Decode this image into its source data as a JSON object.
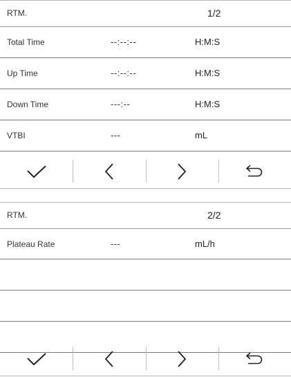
{
  "panels": [
    {
      "title": "RTM.",
      "page": "1/2",
      "rows": [
        {
          "label": "Total Time",
          "value": "--:--:--",
          "unit": "H:M:S"
        },
        {
          "label": "Up Time",
          "value": "--:--:--",
          "unit": "H:M:S"
        },
        {
          "label": "Down Time",
          "value": "---:--",
          "unit": "H:M:S"
        },
        {
          "label": "VTBI",
          "value": "---",
          "unit": "mL"
        }
      ],
      "toolbar": [
        "check-icon",
        "chevron-left-icon",
        "chevron-right-icon",
        "return-icon"
      ]
    },
    {
      "title": "RTM.",
      "page": "2/2",
      "rows": [
        {
          "label": "Plateau Rate",
          "value": "---",
          "unit": "mL/h"
        }
      ],
      "toolbar": [
        "check-icon",
        "chevron-left-icon",
        "chevron-right-icon",
        "return-icon"
      ]
    }
  ]
}
